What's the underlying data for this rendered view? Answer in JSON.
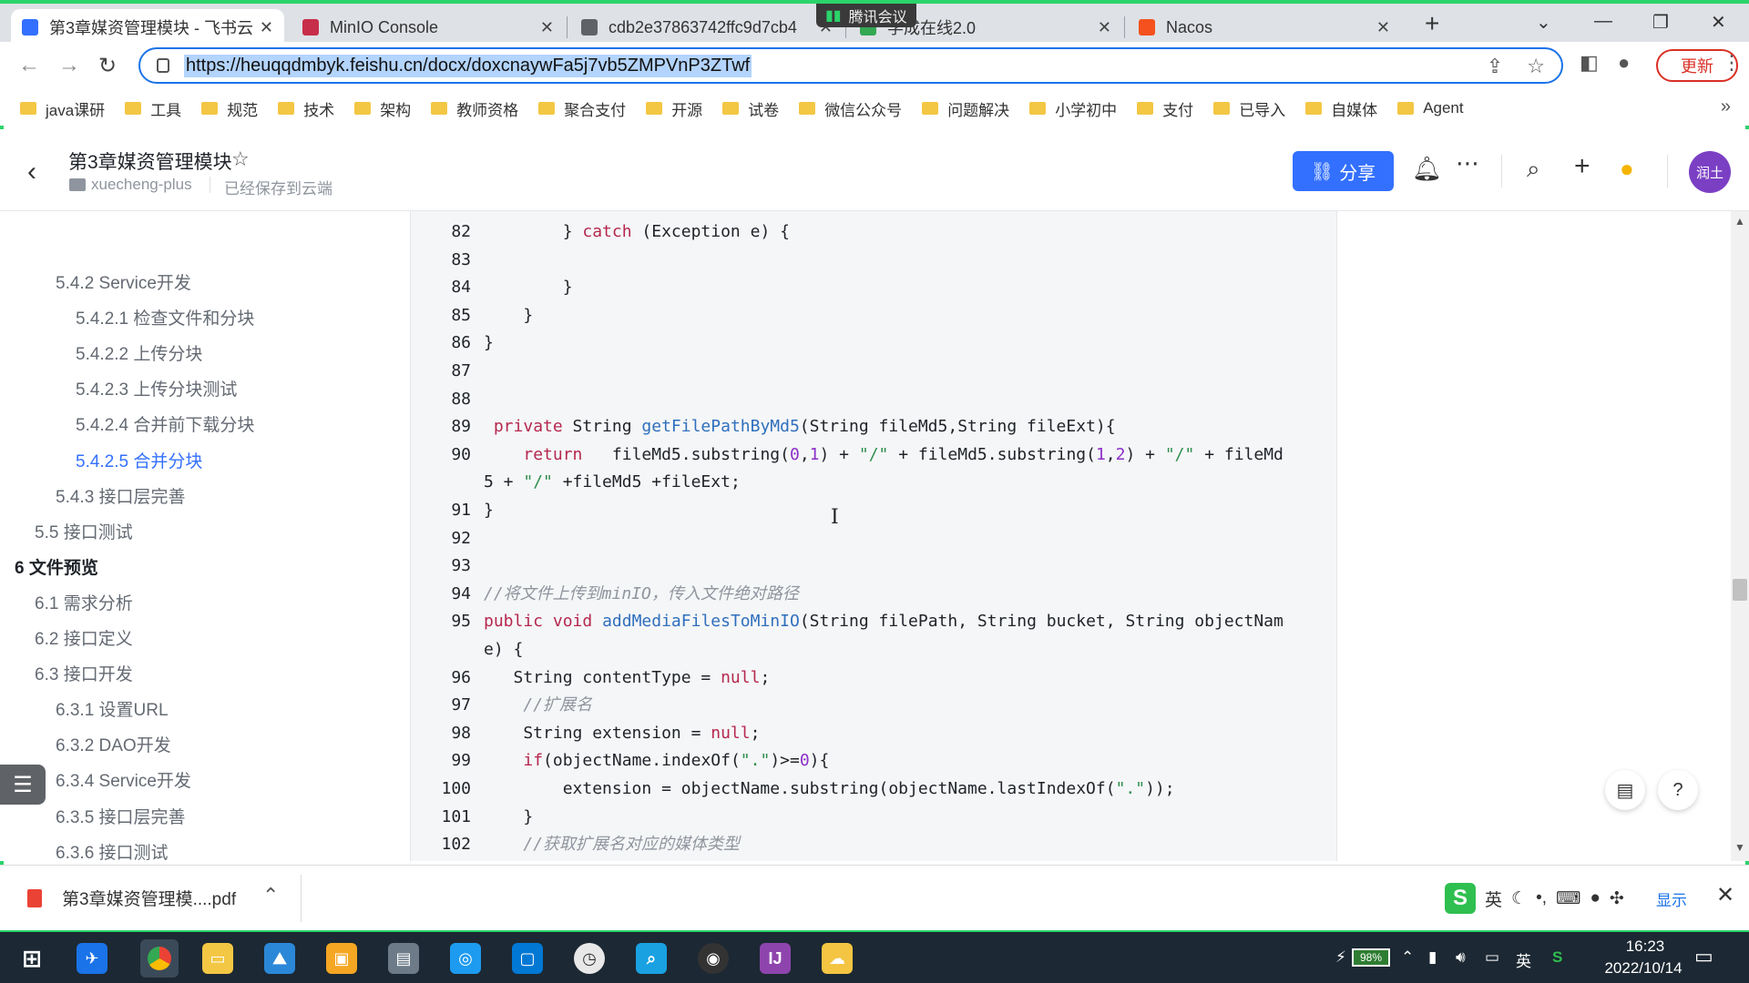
{
  "browser": {
    "tabs": [
      {
        "label": "第3章媒资管理模块 - 飞书云",
        "active": true,
        "icon_color": "#3370ff"
      },
      {
        "label": "MinIO Console",
        "active": false,
        "icon_color": "#c72e49"
      },
      {
        "label": "cdb2e37863742ffc9d7cb4",
        "active": false,
        "icon_color": "#5f6368"
      },
      {
        "label": "学成在线2.0",
        "active": false,
        "icon_color": "#34a853"
      },
      {
        "label": "Nacos",
        "active": false,
        "icon_color": "#f4511e"
      }
    ],
    "meeting_label": "腾讯会议",
    "url": "https://heuqqdmbyk.feishu.cn/docx/doxcnaywFa5j7vb5ZMPVnP3ZTwf",
    "update_label": "更新",
    "bookmarks": [
      "java课研",
      "工具",
      "规范",
      "技术",
      "架构",
      "教师资格",
      "聚合支付",
      "开源",
      "试卷",
      "微信公众号",
      "问题解决",
      "小学初中",
      "支付",
      "已导入",
      "自媒体",
      "Agent"
    ]
  },
  "doc": {
    "title": "第3章媒资管理模块",
    "space": "xuecheng-plus",
    "saved_status": "已经保存到云端",
    "share_label": "分享",
    "avatar_text": "润土"
  },
  "toc": [
    {
      "label": "5.4.2 Service开发",
      "level": 2,
      "active": false
    },
    {
      "label": "5.4.2.1 检查文件和分块",
      "level": 3,
      "active": false
    },
    {
      "label": "5.4.2.2 上传分块",
      "level": 3,
      "active": false
    },
    {
      "label": "5.4.2.3 上传分块测试",
      "level": 3,
      "active": false
    },
    {
      "label": "5.4.2.4 合并前下载分块",
      "level": 3,
      "active": false
    },
    {
      "label": "5.4.2.5 合并分块",
      "level": 3,
      "active": true
    },
    {
      "label": "5.4.3 接口层完善",
      "level": 2,
      "active": false
    },
    {
      "label": "5.5 接口测试",
      "level": 1,
      "active": false
    },
    {
      "label": "6 文件预览",
      "level": 0,
      "active": false
    },
    {
      "label": "6.1 需求分析",
      "level": 1,
      "active": false
    },
    {
      "label": "6.2 接口定义",
      "level": 1,
      "active": false
    },
    {
      "label": "6.3 接口开发",
      "level": 1,
      "active": false
    },
    {
      "label": "6.3.1 设置URL",
      "level": 2,
      "active": false
    },
    {
      "label": "6.3.2 DAO开发",
      "level": 2,
      "active": false
    },
    {
      "label": "6.3.4 Service开发",
      "level": 2,
      "active": false
    },
    {
      "label": "6.3.5 接口层完善",
      "level": 2,
      "active": false
    },
    {
      "label": "6.3.6 接口测试",
      "level": 2,
      "active": false
    }
  ],
  "code_lines": [
    {
      "n": "82",
      "segs": [
        [
          "",
          "        } "
        ],
        [
          "kw",
          "catch"
        ],
        [
          "",
          " (Exception e) {"
        ]
      ]
    },
    {
      "n": "83",
      "segs": [
        [
          "",
          ""
        ]
      ]
    },
    {
      "n": "84",
      "segs": [
        [
          "",
          "        }"
        ]
      ]
    },
    {
      "n": "85",
      "segs": [
        [
          "",
          "    }"
        ]
      ]
    },
    {
      "n": "86",
      "segs": [
        [
          "",
          "}"
        ]
      ]
    },
    {
      "n": "87",
      "segs": [
        [
          "",
          ""
        ]
      ]
    },
    {
      "n": "88",
      "segs": [
        [
          "",
          ""
        ]
      ]
    },
    {
      "n": "89",
      "segs": [
        [
          "",
          " "
        ],
        [
          "kw",
          "private"
        ],
        [
          "",
          " String "
        ],
        [
          "fn",
          "getFilePathByMd5"
        ],
        [
          "",
          "(String fileMd5,String fileExt){"
        ]
      ]
    },
    {
      "n": "90",
      "segs": [
        [
          "",
          "    "
        ],
        [
          "kw",
          "return"
        ],
        [
          "",
          "   fileMd5.substring("
        ],
        [
          "num",
          "0"
        ],
        [
          "",
          ","
        ],
        [
          "num",
          "1"
        ],
        [
          "",
          ") + "
        ],
        [
          "str",
          "\"/\""
        ],
        [
          "",
          " + fileMd5.substring("
        ],
        [
          "num",
          "1"
        ],
        [
          "",
          ","
        ],
        [
          "num",
          "2"
        ],
        [
          "",
          ") + "
        ],
        [
          "str",
          "\"/\""
        ],
        [
          "",
          " + fileMd"
        ]
      ]
    },
    {
      "n": "",
      "segs": [
        [
          "",
          "5 + "
        ],
        [
          "str",
          "\"/\""
        ],
        [
          "",
          " +fileMd5 +fileExt;"
        ]
      ]
    },
    {
      "n": "91",
      "segs": [
        [
          "",
          "}"
        ]
      ]
    },
    {
      "n": "92",
      "segs": [
        [
          "",
          ""
        ]
      ]
    },
    {
      "n": "93",
      "segs": [
        [
          "",
          ""
        ]
      ]
    },
    {
      "n": "94",
      "segs": [
        [
          "cm",
          "//将文件上传到minIO，传入文件绝对路径"
        ]
      ]
    },
    {
      "n": "95",
      "segs": [
        [
          "kw",
          "public"
        ],
        [
          "",
          " "
        ],
        [
          "kw",
          "void"
        ],
        [
          "",
          " "
        ],
        [
          "fn",
          "addMediaFilesToMinIO"
        ],
        [
          "",
          "(String filePath, String bucket, String objectNam"
        ]
      ]
    },
    {
      "n": "",
      "segs": [
        [
          "",
          "e) {"
        ]
      ]
    },
    {
      "n": "96",
      "segs": [
        [
          "",
          "   String contentType = "
        ],
        [
          "kw",
          "null"
        ],
        [
          "",
          ";"
        ]
      ]
    },
    {
      "n": "97",
      "segs": [
        [
          "",
          "    "
        ],
        [
          "cm",
          "//扩展名"
        ]
      ]
    },
    {
      "n": "98",
      "segs": [
        [
          "",
          "    String extension = "
        ],
        [
          "kw",
          "null"
        ],
        [
          "",
          ";"
        ]
      ]
    },
    {
      "n": "99",
      "segs": [
        [
          "",
          "    "
        ],
        [
          "kw",
          "if"
        ],
        [
          "",
          "(objectName.indexOf("
        ],
        [
          "str",
          "\".\""
        ],
        [
          "",
          ")>="
        ],
        [
          "num",
          "0"
        ],
        [
          "",
          "){"
        ]
      ]
    },
    {
      "n": "100",
      "segs": [
        [
          "",
          "        extension = objectName.substring(objectName.lastIndexOf("
        ],
        [
          "str",
          "\".\""
        ],
        [
          "",
          "));"
        ]
      ]
    },
    {
      "n": "101",
      "segs": [
        [
          "",
          "    }"
        ]
      ]
    },
    {
      "n": "102",
      "segs": [
        [
          "",
          "    "
        ],
        [
          "cm",
          "//获取扩展名对应的媒体类型"
        ]
      ]
    }
  ],
  "download": {
    "filename": "第3章媒资管理模....pdf",
    "show_all": "显示"
  },
  "ime": {
    "lang": "英"
  },
  "taskbar": {
    "battery": "98%",
    "lang": "英",
    "time": "16:23",
    "date": "2022/10/14"
  },
  "icons": {
    "back": "chevron-left-icon",
    "star": "star-icon",
    "bell": "bell-icon",
    "more": "ellipsis-icon",
    "search": "search-icon",
    "plus": "plus-icon",
    "bulb": "lightbulb-icon"
  }
}
